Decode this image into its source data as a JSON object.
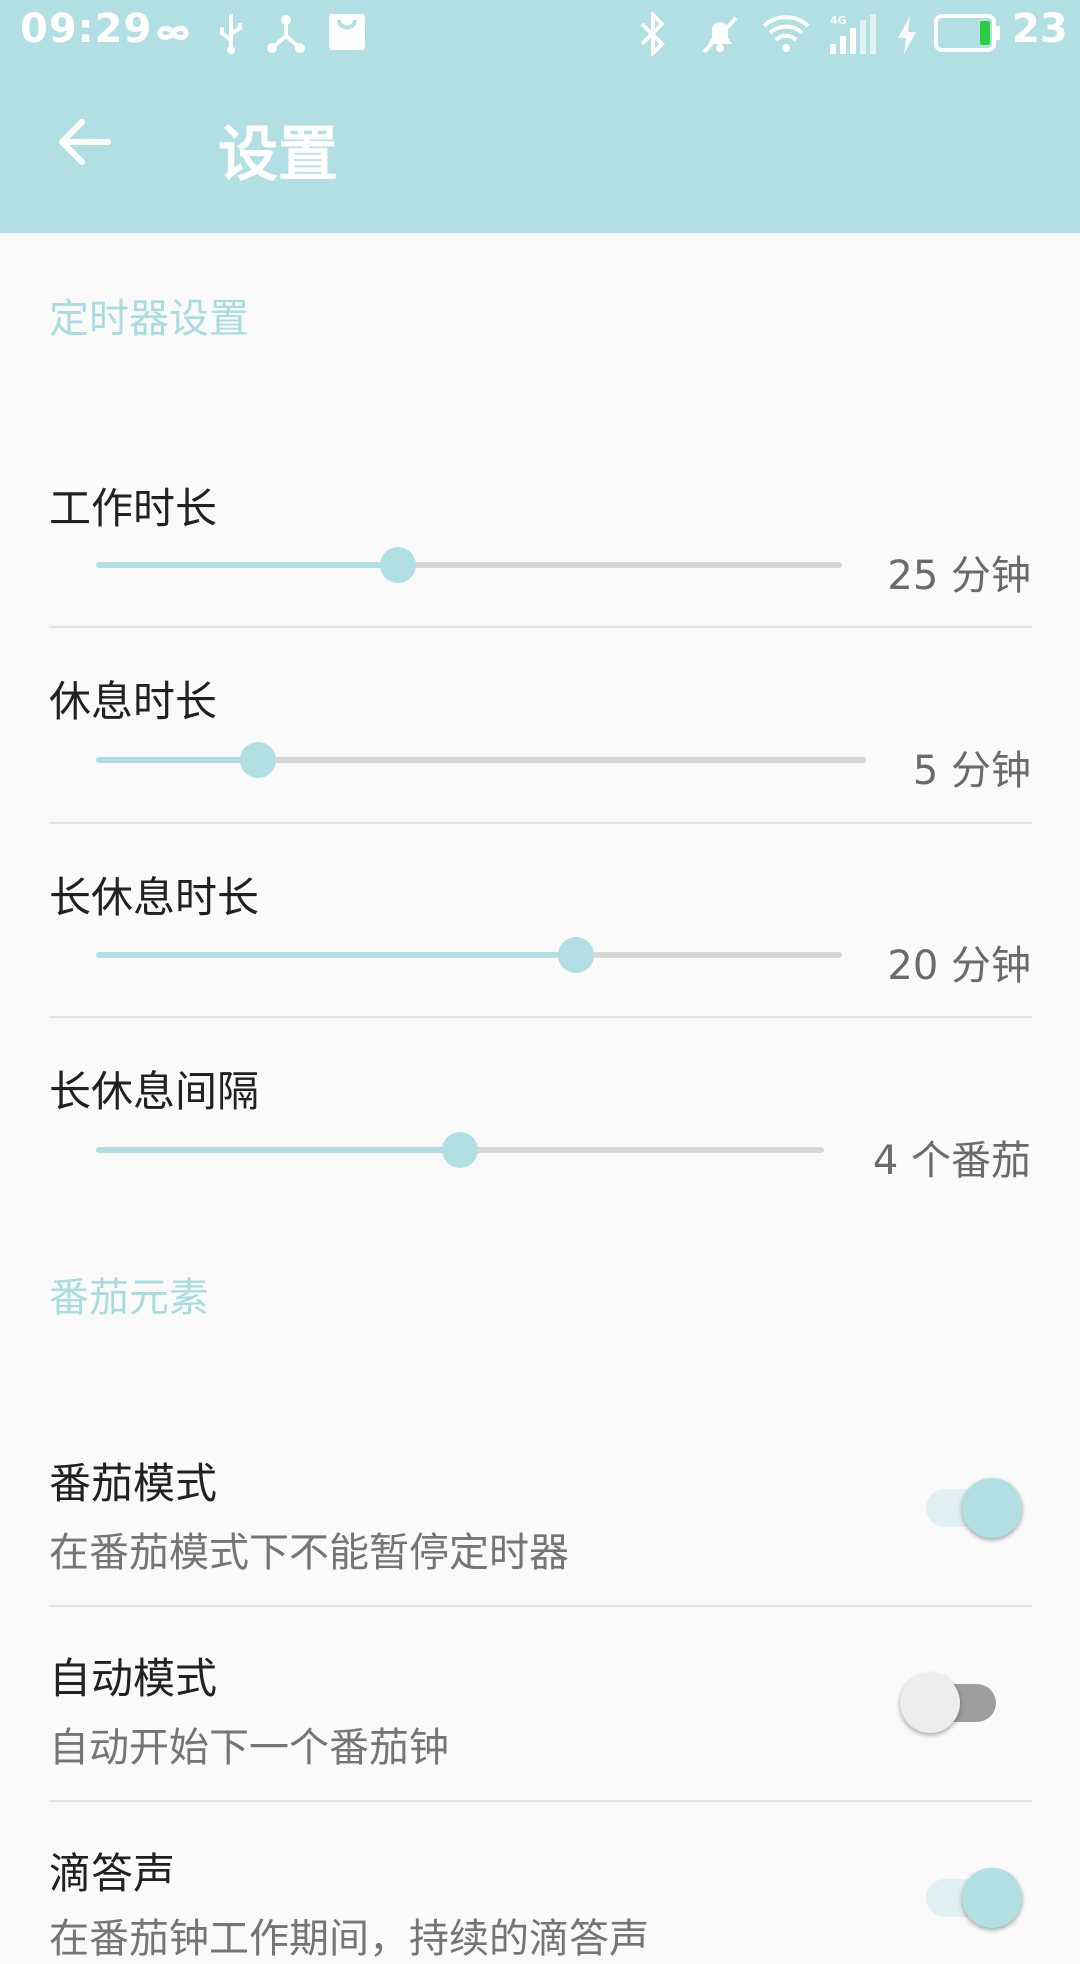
{
  "status_bar": {
    "time": "09:29",
    "battery_text": "23",
    "icons": [
      "infinity-icon",
      "usb-icon",
      "share-icon",
      "shopping-bag-icon",
      "bluetooth-icon",
      "notifications-off-icon",
      "wifi-icon",
      "signal-4g-icon",
      "charging-icon",
      "battery-icon"
    ]
  },
  "toolbar": {
    "title": "设置"
  },
  "sections": {
    "timer": "定时器设置",
    "tomato": "番茄元素"
  },
  "sliders": [
    {
      "label": "工作时长",
      "value_text": "25 分钟",
      "fraction": 0.405
    },
    {
      "label": "休息时长",
      "value_text": "5 分钟",
      "fraction": 0.21
    },
    {
      "label": "长休息时长",
      "value_text": "20 分钟",
      "fraction": 0.643
    },
    {
      "label": "长休息间隔",
      "value_text": "4 个番茄",
      "fraction": 0.5
    }
  ],
  "switches": [
    {
      "label": "番茄模式",
      "description": "在番茄模式下不能暂停定时器",
      "on": true
    },
    {
      "label": "自动模式",
      "description": "自动开始下一个番茄钟",
      "on": false
    },
    {
      "label": "滴答声",
      "description": "在番茄钟工作期间，持续的滴答声",
      "on": true
    }
  ],
  "colors": {
    "accent": "#B1DFE4",
    "track_off": "#D7D7D7",
    "switch_off_thumb": "#EDEDED",
    "switch_off_track": "#9E9E9E"
  }
}
